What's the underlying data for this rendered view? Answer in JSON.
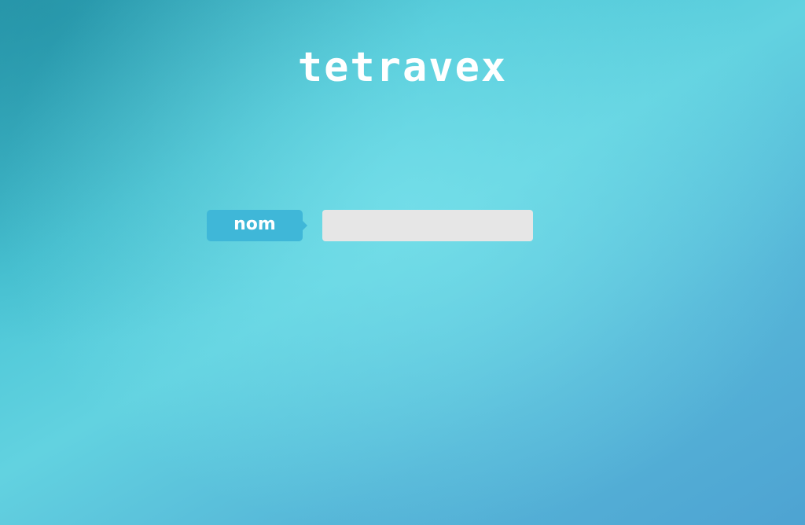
{
  "app": {
    "logo_text": "tetravex"
  },
  "form": {
    "name_label": "nom",
    "name_value": "",
    "name_placeholder": ""
  },
  "colors": {
    "label_background": "#3fb7d8",
    "input_background": "#e6e6e6",
    "text": "#ffffff"
  }
}
